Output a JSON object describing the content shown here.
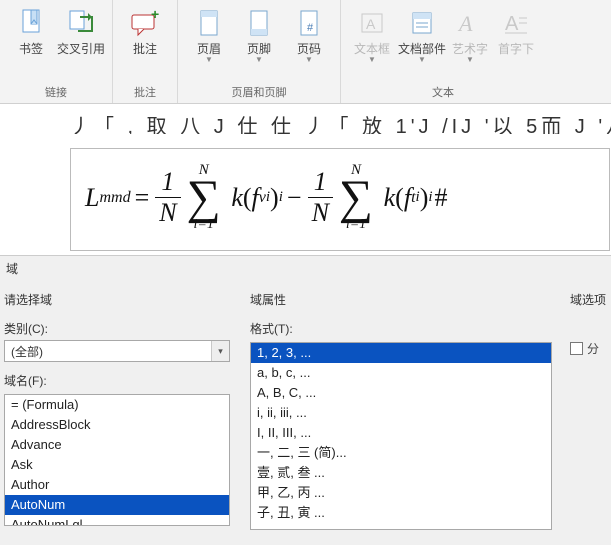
{
  "ribbon": {
    "groups": [
      {
        "title": "链接",
        "buttons": [
          {
            "label": "书签"
          },
          {
            "label": "交叉引用"
          }
        ]
      },
      {
        "title": "批注",
        "buttons": [
          {
            "label": "批注"
          }
        ]
      },
      {
        "title": "页眉和页脚",
        "buttons": [
          {
            "label": "页眉"
          },
          {
            "label": "页脚"
          },
          {
            "label": "页码"
          }
        ]
      },
      {
        "title": "文本",
        "buttons": [
          {
            "label": "文本框"
          },
          {
            "label": "文档部件"
          },
          {
            "label": "艺术字"
          },
          {
            "label": "首字下"
          }
        ]
      }
    ]
  },
  "doc": {
    "partial_line": "丿「 ,   取 八   J 仕 仕 丿「  放  1'J /IJ   '以 5而 J   '八 心 ノJ ノ「 ,"
  },
  "equation": {
    "lhs_var": "L",
    "lhs_sub": "mmd",
    "frac_num": "1",
    "frac_den": "N",
    "sum_upper": "N",
    "sum_lower": "i=1",
    "k": "k",
    "fv": "f",
    "fv_sub": "v",
    "fv_supi": "i",
    "ft": "f",
    "ft_sub": "t",
    "ft_supi": "i",
    "outer_i": "i",
    "minus": "−",
    "equals": "=",
    "lparen": "(",
    "rparen": ")",
    "tail": "#"
  },
  "dialog": {
    "title": "域",
    "left_head": "请选择域",
    "category_label": "类别(C):",
    "category_value": "(全部)",
    "fieldname_label": "域名(F):",
    "field_names": [
      "= (Formula)",
      "AddressBlock",
      "Advance",
      "Ask",
      "Author",
      "AutoNum",
      "AutoNumLgl"
    ],
    "field_selected_index": 5,
    "mid_head": "域属性",
    "format_label": "格式(T):",
    "formats": [
      "1, 2, 3, ...",
      "a, b, c, ...",
      "A, B, C, ...",
      "i, ii, iii, ...",
      "I, II, III, ...",
      "一, 二, 三 (简)...",
      "壹, 贰, 叁 ...",
      "甲, 乙, 丙 ...",
      "子, 丑, 寅 ..."
    ],
    "format_selected_index": 0,
    "right_head": "域选项",
    "right_checkbox_label": "分"
  }
}
